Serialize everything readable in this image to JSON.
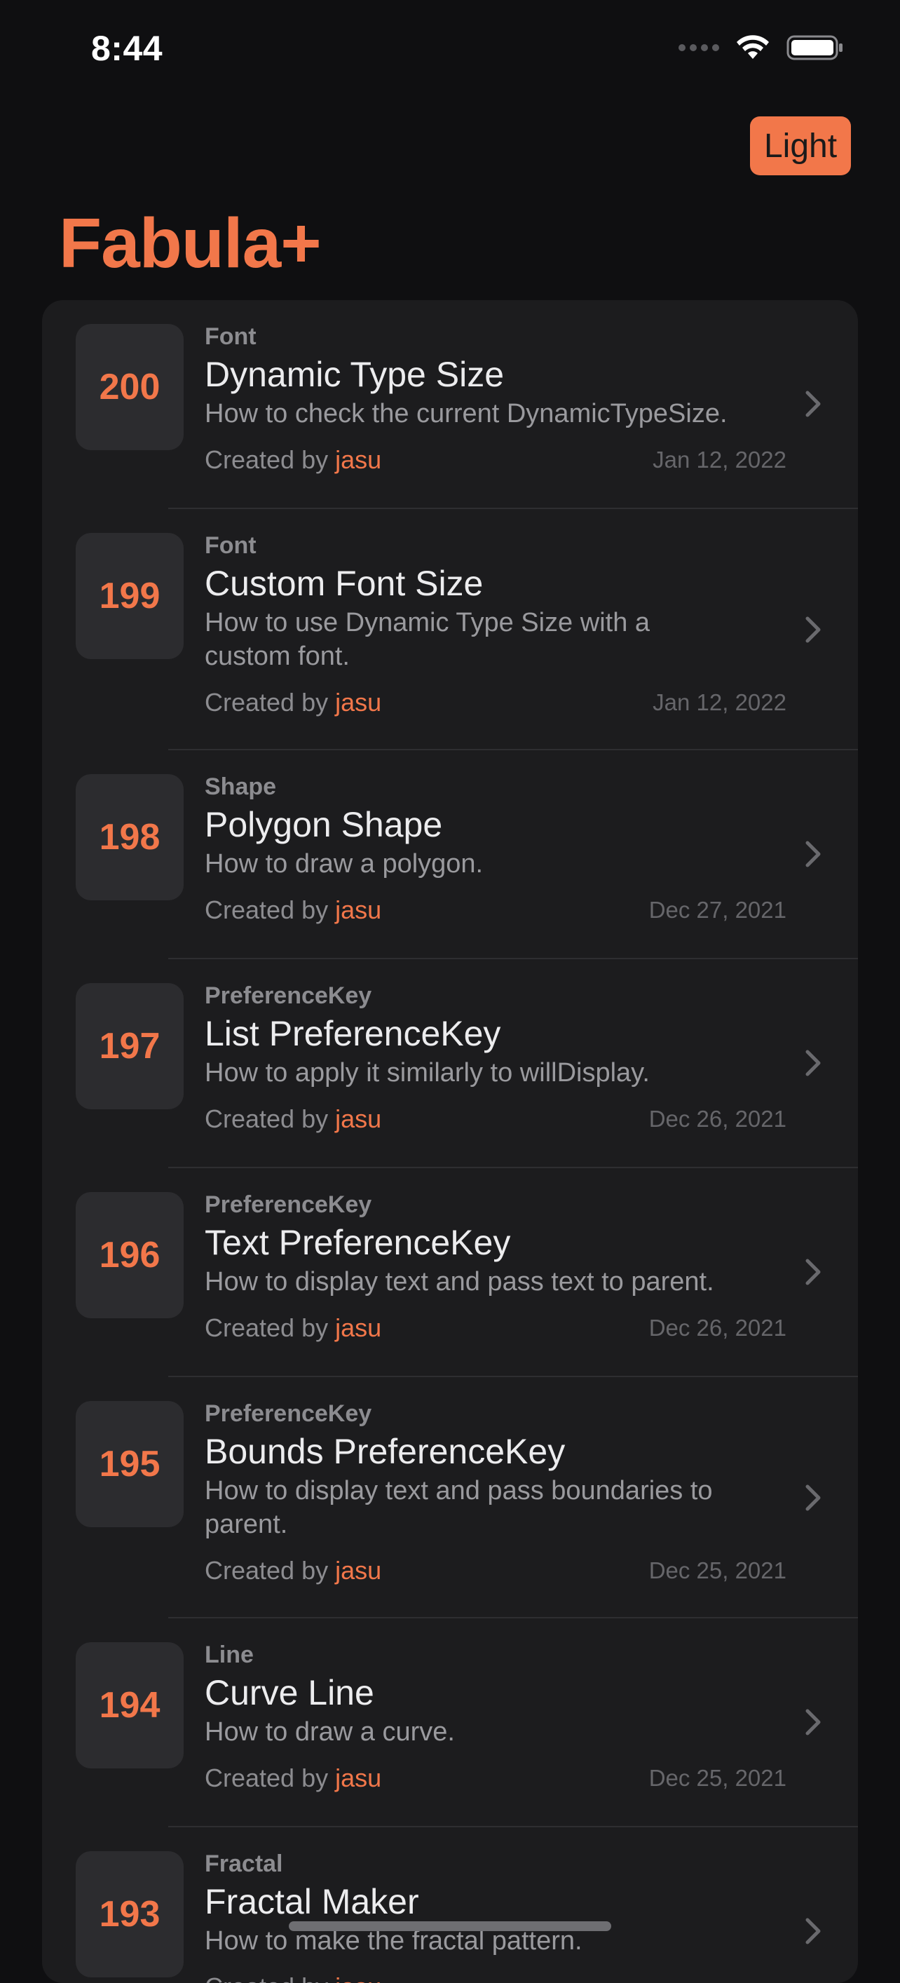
{
  "status": {
    "time": "8:44"
  },
  "header": {
    "mode_button": "Light",
    "title": "Fabula+"
  },
  "colors": {
    "accent": "#f2774a",
    "background": "#0f0f11",
    "card": "#1c1c1e"
  },
  "items": [
    {
      "number": "200",
      "category": "Font",
      "title": "Dynamic Type Size",
      "description": "How to check the current DynamicTypeSize.",
      "created_label": "Created by",
      "author": "jasu",
      "date": "Jan 12, 2022"
    },
    {
      "number": "199",
      "category": "Font",
      "title": "Custom Font Size",
      "description": "How to use Dynamic Type Size with a custom font.",
      "created_label": "Created by",
      "author": "jasu",
      "date": "Jan 12, 2022"
    },
    {
      "number": "198",
      "category": "Shape",
      "title": "Polygon Shape",
      "description": "How to draw a polygon.",
      "created_label": "Created by",
      "author": "jasu",
      "date": "Dec 27, 2021"
    },
    {
      "number": "197",
      "category": "PreferenceKey",
      "title": "List PreferenceKey",
      "description": "How to apply it similarly to willDisplay.",
      "created_label": "Created by",
      "author": "jasu",
      "date": "Dec 26, 2021"
    },
    {
      "number": "196",
      "category": "PreferenceKey",
      "title": "Text PreferenceKey",
      "description": "How to display text and pass text to parent.",
      "created_label": "Created by",
      "author": "jasu",
      "date": "Dec 26, 2021"
    },
    {
      "number": "195",
      "category": "PreferenceKey",
      "title": "Bounds PreferenceKey",
      "description": "How to display text and pass boundaries to parent.",
      "created_label": "Created by",
      "author": "jasu",
      "date": "Dec 25, 2021"
    },
    {
      "number": "194",
      "category": "Line",
      "title": "Curve Line",
      "description": "How to draw a curve.",
      "created_label": "Created by",
      "author": "jasu",
      "date": "Dec 25, 2021"
    },
    {
      "number": "193",
      "category": "Fractal",
      "title": "Fractal Maker",
      "description": "How to make the fractal pattern.",
      "created_label": "Created by",
      "author": "jasu",
      "date": ""
    }
  ]
}
